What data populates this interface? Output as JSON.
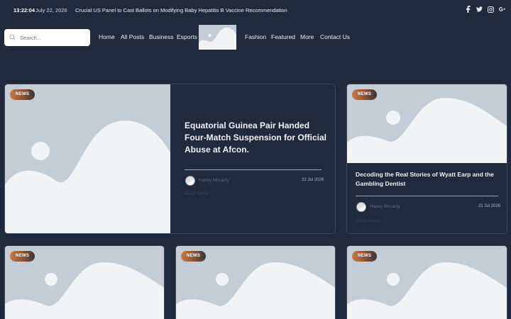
{
  "topbar": {
    "time": "13:22:04",
    "date": "July 22, 2026",
    "ticker": "Crucial US Panel to Cast Ballots on Modifying Baby Hepatitis B Vaccine Recommendation",
    "social": [
      "facebook-icon",
      "twitter-icon",
      "instagram-icon",
      "google-plus-icon"
    ]
  },
  "search": {
    "placeholder": "Search..."
  },
  "nav": {
    "items": [
      "Home",
      "All Posts",
      "Business",
      "Esports",
      "Fashion",
      "Featured",
      "More",
      "Contact Us"
    ]
  },
  "featured": {
    "badge": "NEWS",
    "title": "Equatorial Guinea Pair Handed Four-Match Suspension for Official Abuse at Afcon.",
    "author": "Hailey Mccarty",
    "date": "22 Jul 2026",
    "read_more": "Read Article →"
  },
  "side_card": {
    "badge": "NEWS",
    "title": "Decoding the Real Stories of Wyatt Earp and the Gambling Dentist",
    "author": "Hailey Mccarty",
    "date": "21 Jul 2026",
    "read_more": "Read Article →"
  },
  "bottom_cards": [
    {
      "badge": "NEWS"
    },
    {
      "badge": "NEWS"
    },
    {
      "badge": "NEWS"
    }
  ],
  "colors": {
    "background": "#1f2a3d",
    "placeholder": "#c4ccd6",
    "badge_start": "#c87b45",
    "badge_end": "#3e3332"
  }
}
